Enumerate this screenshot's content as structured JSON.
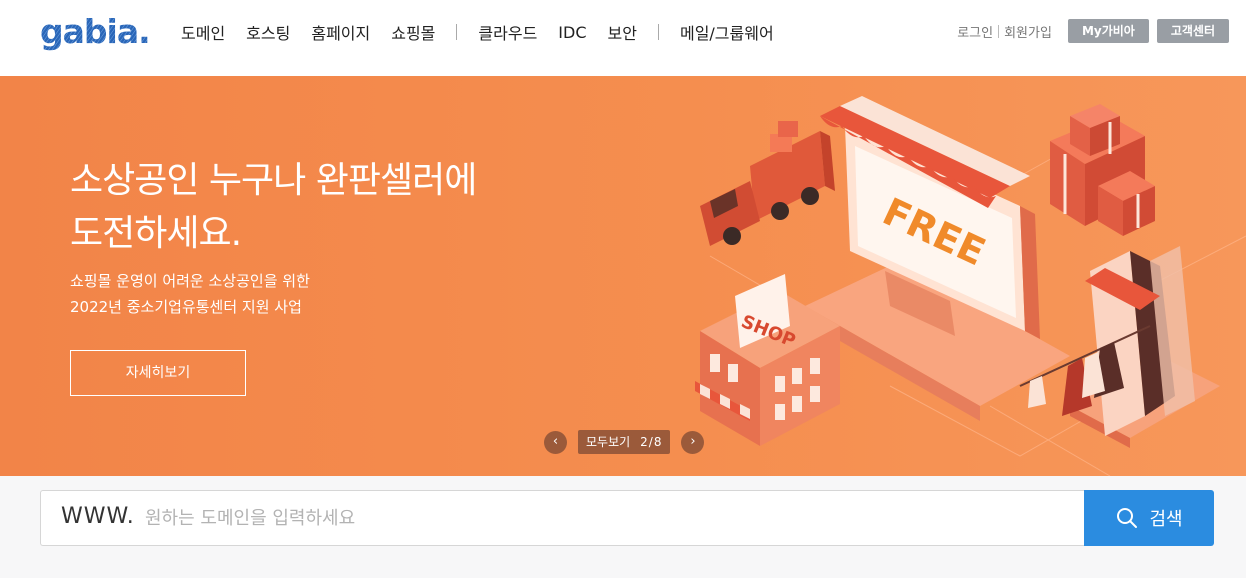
{
  "header": {
    "logo_text": "gabia.",
    "nav": [
      "도메인",
      "호스팅",
      "홈페이지",
      "쇼핑몰",
      "클라우드",
      "IDC",
      "보안",
      "메일/그룹웨어"
    ],
    "login": "로그인",
    "signup": "회원가입",
    "my_button": "My가비아",
    "support_button": "고객센터"
  },
  "banner": {
    "title_line1": "소상공인 누구나 완판셀러에",
    "title_line2": "도전하세요.",
    "desc_line1": "쇼핑몰 운영이 어려운 소상공인을 위한",
    "desc_line2": "2022년 중소기업유통센터 지원 사업",
    "detail_button": "자세히보기",
    "illustration_labels": {
      "monitor": "FREE",
      "shop": "SHOP"
    },
    "pager_label": "모두보기",
    "pager_count": "2/8",
    "prev_icon": "‹",
    "next_icon": "›"
  },
  "search": {
    "prefix": "WWW.",
    "placeholder": "원하는 도메인을 입력하세요",
    "button_label": "검색"
  },
  "colors": {
    "banner_bg": "#f58e4f",
    "search_button": "#2b8ce0",
    "util_button": "#999ea4",
    "logo": "#2a66b8"
  }
}
